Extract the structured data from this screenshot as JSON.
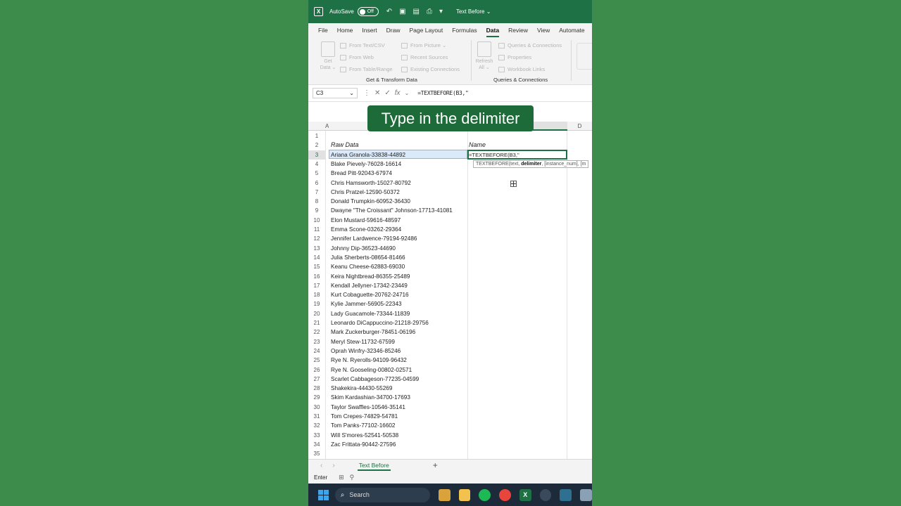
{
  "titlebar": {
    "autosave_label": "AutoSave",
    "toggle_state": "Off",
    "doc_title": "Text Before ⌄"
  },
  "menu": {
    "tabs": [
      "File",
      "Home",
      "Insert",
      "Draw",
      "Page Layout",
      "Formulas",
      "Data",
      "Review",
      "View",
      "Automate"
    ],
    "active": "Data"
  },
  "ribbon": {
    "get_data": "Get\nData ⌄",
    "from_text_csv": "From Text/CSV",
    "from_web": "From Web",
    "from_table_range": "From Table/Range",
    "from_picture": "From Picture ⌄",
    "recent_sources": "Recent Sources",
    "existing_connections": "Existing Connections",
    "group_get_transform": "Get & Transform Data",
    "refresh_all": "Refresh\nAll ⌄",
    "queries_connections": "Queries & Connections",
    "properties": "Properties",
    "workbook_links": "Workbook Links",
    "group_queries": "Queries & Connections"
  },
  "formula_bar": {
    "name_box": "C3",
    "formula": "=TEXTBEFORE(B3,\""
  },
  "overlay_caption": "Type in the delimiter",
  "columns": {
    "a": "A",
    "d": "D"
  },
  "headers": {
    "raw_data": "Raw Data",
    "name": "Name"
  },
  "active_cell_text": "=TEXTBEFORE(B3,\"",
  "tooltip": {
    "prefix": "TEXTBEFORE(text, ",
    "bold": "delimiter",
    "suffix": ", [instance_num], [m"
  },
  "rows": [
    "Ariana Granola-33838-44892",
    "Blake Pievely-76028-16614",
    "Bread Pitt-92043-67974",
    "Chris Hamsworth-15027-80792",
    "Chris Pratzel-12590-50372",
    "Donald Trumpkin-60952-36430",
    "Dwayne \"The Croissant\" Johnson-17713-41081",
    "Elon Mustard-59616-48597",
    "Emma Scone-03262-29364",
    "Jennifer Lardwence-79194-92486",
    "Johnny Dip-36523-44690",
    "Julia Sherberts-08654-81466",
    "Keanu Cheese-62883-69030",
    "Keira Nightbread-86355-25489",
    "Kendall Jellyner-17342-23449",
    "Kurt Cobaguette-20762-24716",
    "Kylie Jammer-56905-22343",
    "Lady Guacamole-73344-11839",
    "Leonardo DiCappuccino-21218-29756",
    "Mark Zuckerburger-78451-06196",
    "Meryl Stew-11732-67599",
    "Oprah Winfry-32346-85246",
    "Rye N. Ryerolls-94109-96432",
    "Rye N. Gooseling-00802-02571",
    "Scarlet Cabbageson-77235-04599",
    "Shakekira-44430-55269",
    "Skim Kardashian-34700-17693",
    "Taylor Swaffles-10546-35141",
    "Tom Crepes-74829-54781",
    "Tom Panks-77102-16602",
    "Will S'mores-52541-50538",
    "Zac Frittata-90442-27596"
  ],
  "row_numbers": [
    "1",
    "2",
    "3",
    "4",
    "5",
    "6",
    "7",
    "8",
    "9",
    "10",
    "11",
    "12",
    "13",
    "14",
    "15",
    "16",
    "17",
    "18",
    "19",
    "20",
    "21",
    "22",
    "23",
    "24",
    "25",
    "26",
    "27",
    "28",
    "29",
    "30",
    "31",
    "32",
    "33",
    "34",
    "35"
  ],
  "sheet_tab": "Text Before",
  "status": "Enter",
  "taskbar": {
    "search_placeholder": "Search"
  },
  "colors": {
    "excel_green": "#1e7145",
    "background": "#3d8c4b"
  }
}
